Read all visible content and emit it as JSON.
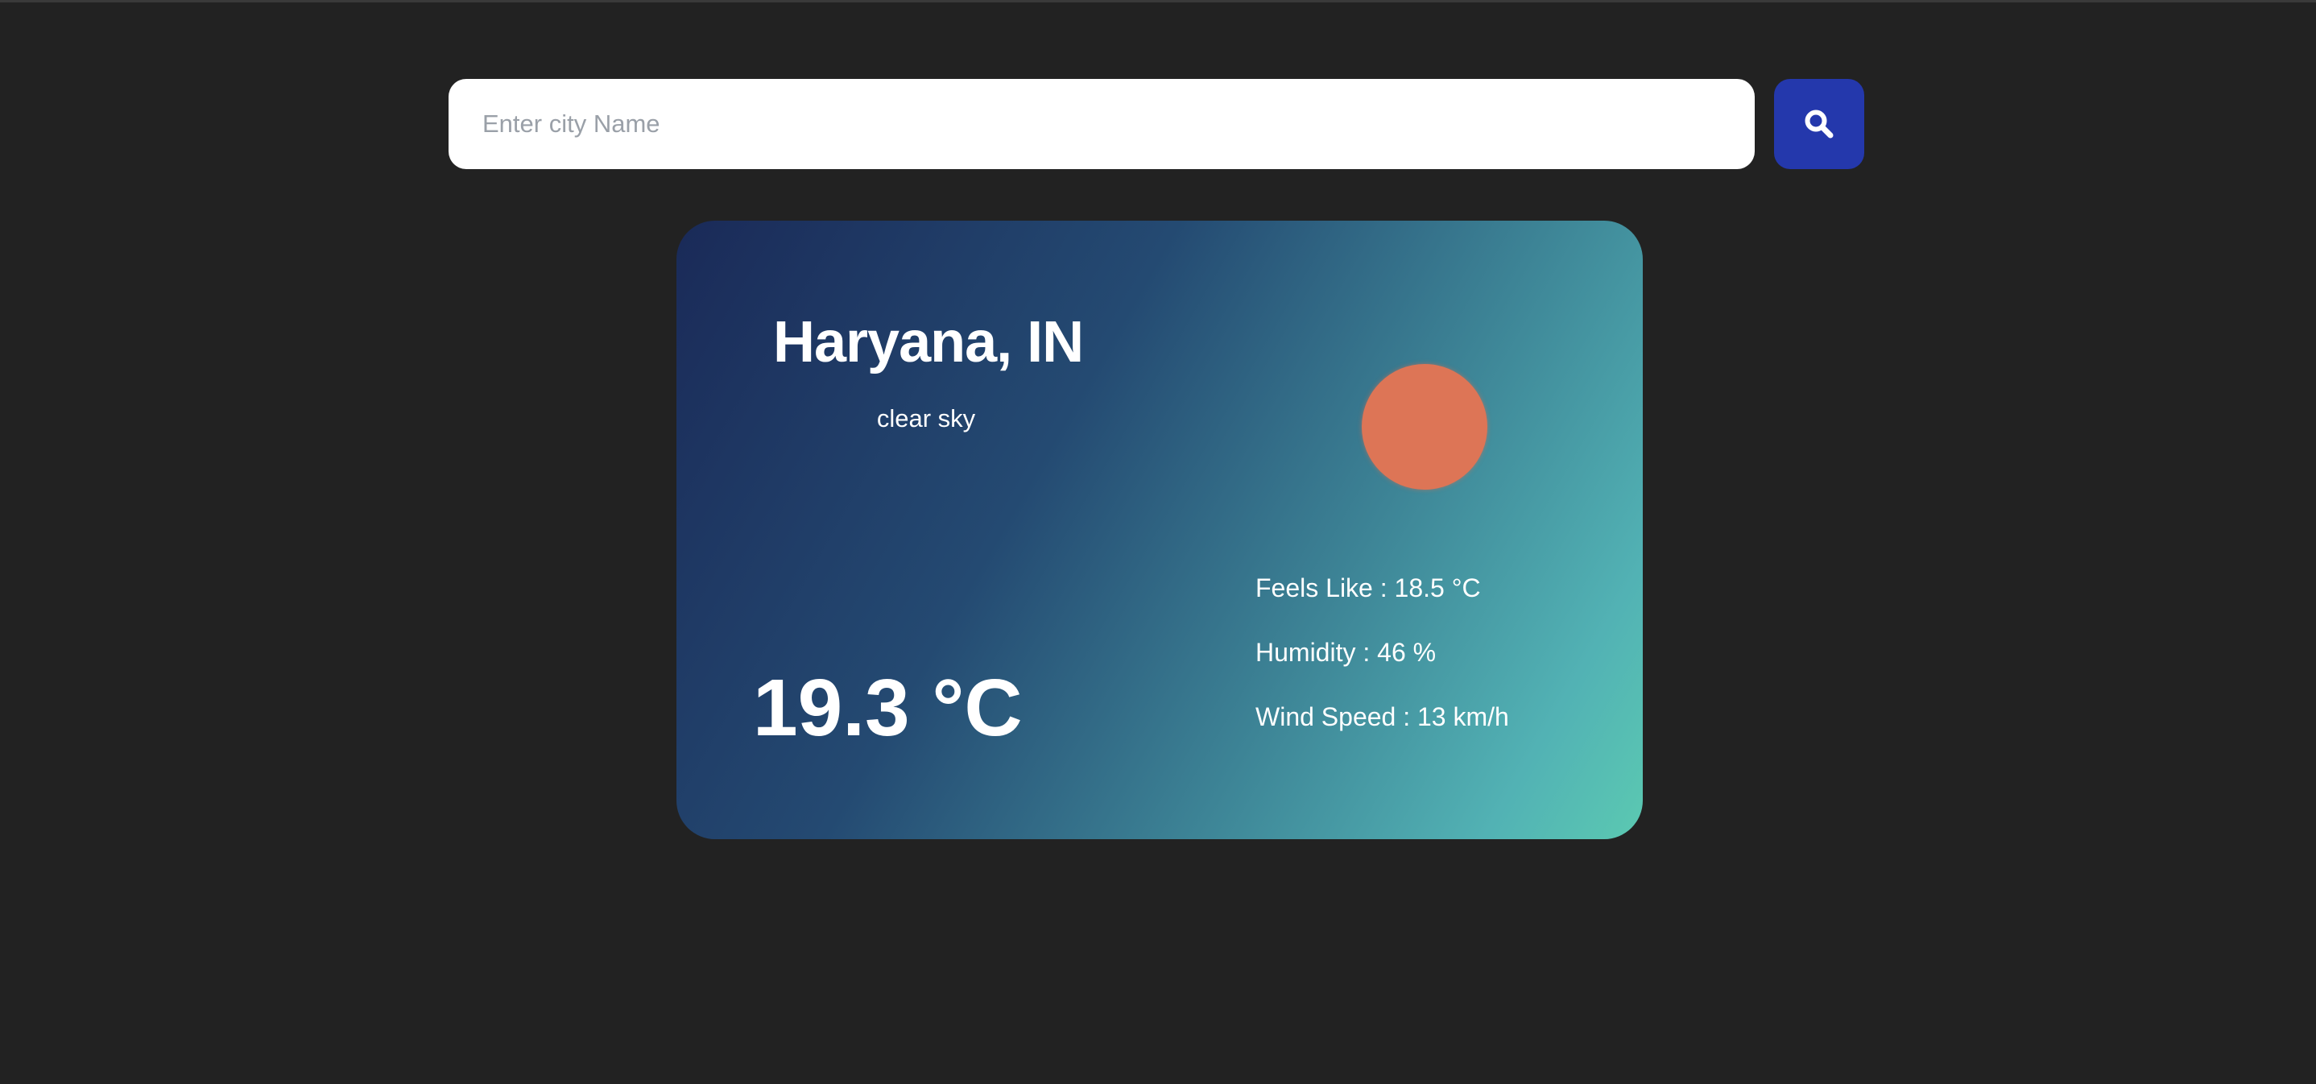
{
  "search": {
    "placeholder": "Enter city Name",
    "value": "",
    "button_icon": "search-icon"
  },
  "weather": {
    "location": "Haryana, IN",
    "description": "clear sky",
    "icon": "sun-icon",
    "temperature": "19.3 °C",
    "feels_like": "Feels Like : 18.5 °C",
    "humidity": "Humidity : 46 %",
    "wind_speed": "Wind Speed : 13 km/h"
  },
  "colors": {
    "background": "#222222",
    "search_button": "#2438ac",
    "card_gradient_start": "#1a2a58",
    "card_gradient_end": "#5bc9b2",
    "sun": "#dd7556"
  }
}
